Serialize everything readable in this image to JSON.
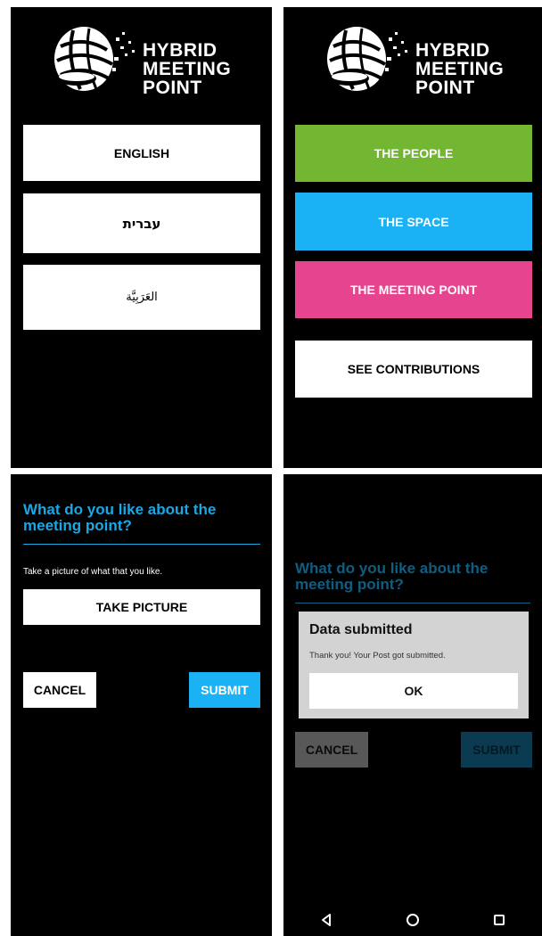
{
  "brand": {
    "line1": "HYBRID",
    "line2": "MEETING",
    "line3": "POINT"
  },
  "screen_language": {
    "english": "ENGLISH",
    "hebrew": "עברית",
    "arabic": "العَرَبِيَّة"
  },
  "screen_menu": {
    "people": "THE PEOPLE",
    "space": "THE SPACE",
    "meeting_point": "THE MEETING POINT",
    "see_contributions": "SEE CONTRIBUTIONS"
  },
  "screen_question": {
    "title_line1": "What do you like about the",
    "title_line2": "meeting point?",
    "instruction": "Take a picture of what that you like.",
    "take_picture": "TAKE PICTURE",
    "cancel": "CANCEL",
    "submit": "SUBMIT"
  },
  "screen_submitted": {
    "title_line1": "What do you like about the",
    "title_line2": "meeting point?",
    "cancel": "CANCEL",
    "submit": "SUBMIT",
    "dialog": {
      "title": "Data submitted",
      "message": "Thank you! Your Post got submitted.",
      "ok": "OK"
    }
  },
  "colors": {
    "green": "#72b631",
    "blue": "#1ab2f5",
    "pink": "#e6448f",
    "accent": "#19a8e6"
  },
  "icons": {
    "logo": "globe-logo-icon",
    "nav_back": "back-triangle-icon",
    "nav_home": "home-circle-icon",
    "nav_recents": "recents-square-icon"
  }
}
